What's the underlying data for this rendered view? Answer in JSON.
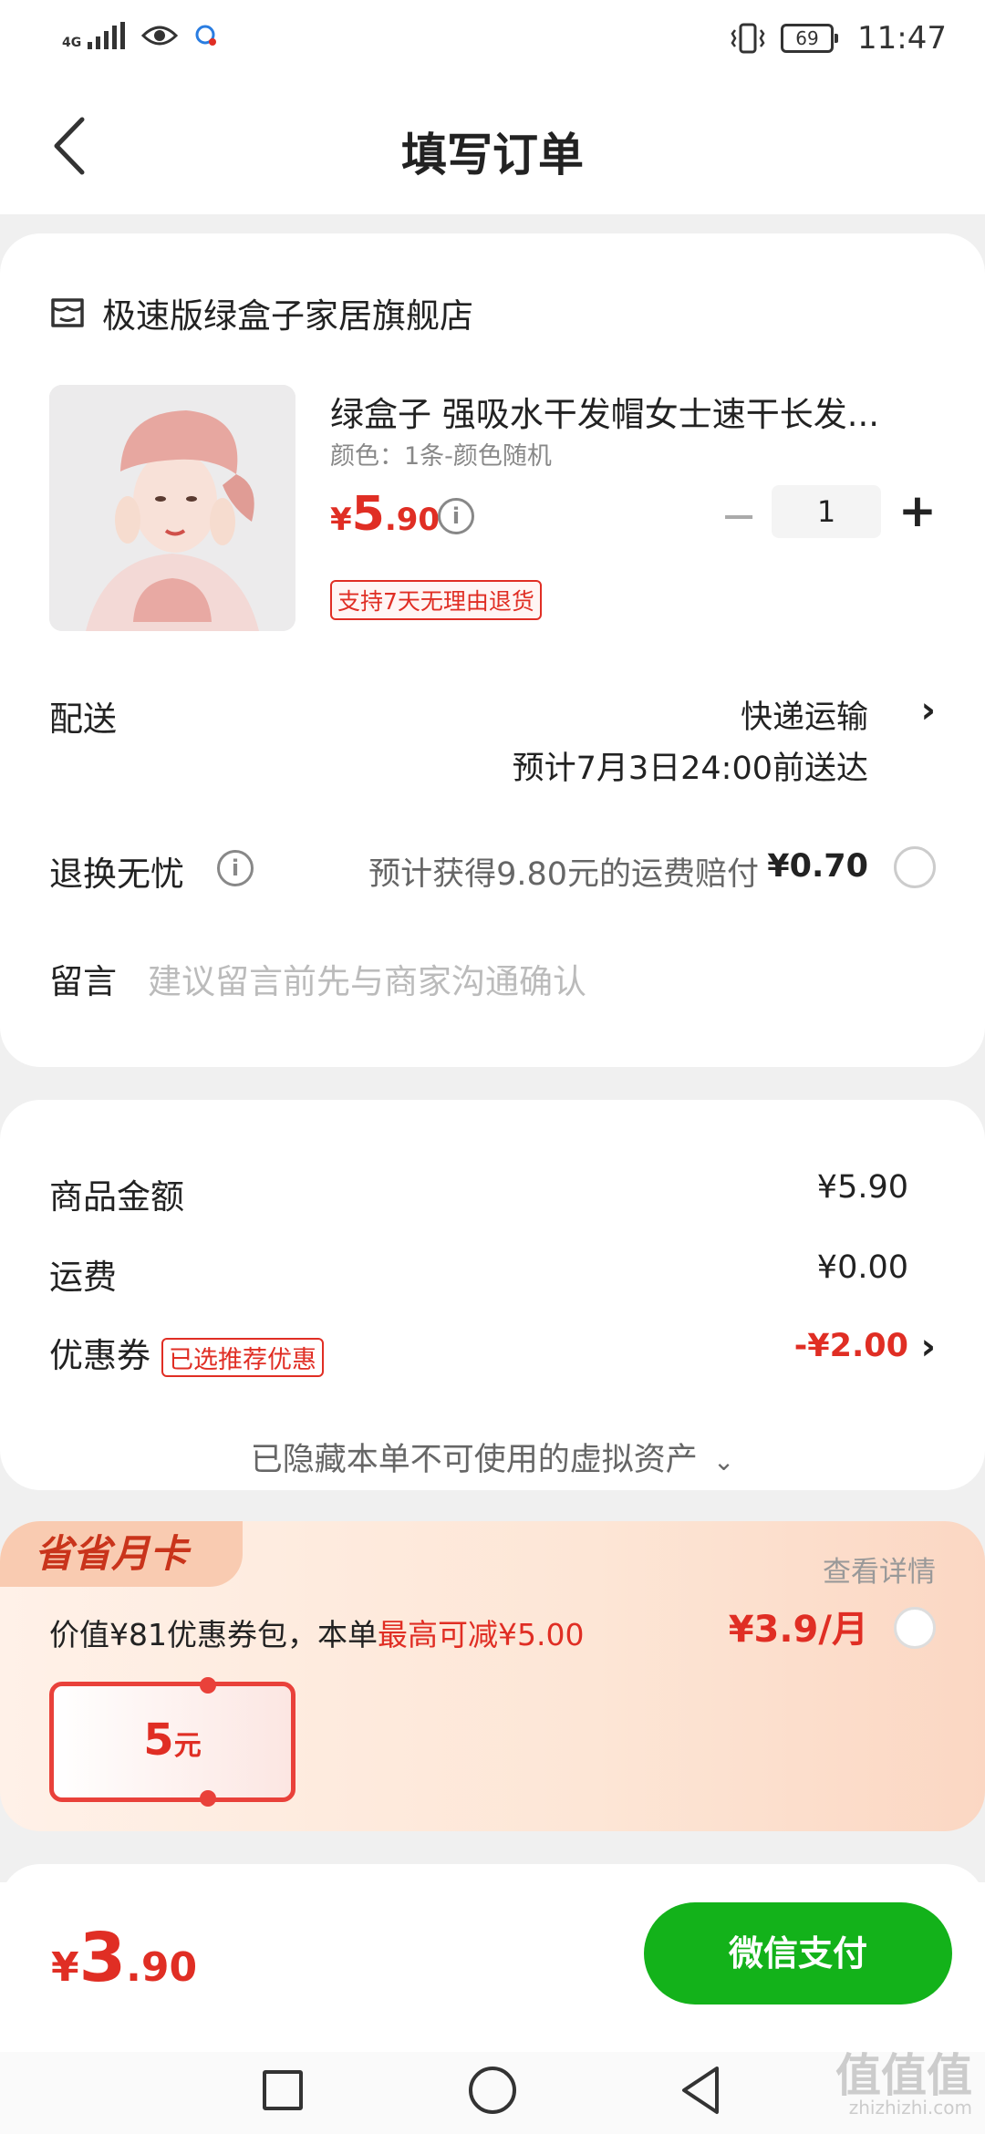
{
  "status_bar": {
    "network": "4G",
    "battery": "69",
    "time": "11:47"
  },
  "header": {
    "title": "填写订单"
  },
  "order": {
    "shop_name": "极速版绿盒子家居旗舰店",
    "product_name": "绿盒子 强吸水干发帽女士速干长发...",
    "spec": "颜色：1条-颜色随机",
    "price_symbol": "¥",
    "price_int": "5",
    "price_dec": ".90",
    "quantity": "1",
    "return_badge": "支持7天无理由退货",
    "delivery_label": "配送",
    "delivery_method": "快递运输",
    "delivery_eta": "预计7月3日24:00前送达",
    "insurance_label": "退换无忧",
    "insurance_desc": "预计获得9.80元的运费赔付",
    "insurance_price": "¥0.70",
    "message_label": "留言",
    "message_placeholder": "建议留言前先与商家沟通确认"
  },
  "summary": {
    "goods_label": "商品金额",
    "goods_value": "¥5.90",
    "shipping_label": "运费",
    "shipping_value": "¥0.00",
    "coupon_label": "优惠券",
    "coupon_badge": "已选推荐优惠",
    "coupon_value": "-¥2.00",
    "hidden_assets": "已隐藏本单不可使用的虚拟资产"
  },
  "promo": {
    "tag": "省省月卡",
    "detail_link": "查看详情",
    "desc_prefix": "价值¥81优惠券包，本单",
    "desc_highlight": "最高可减¥5.00",
    "price": "¥3.9/月",
    "ticket_value": "5",
    "ticket_unit": "元"
  },
  "bottom": {
    "total_symbol": "¥",
    "total_int": "3",
    "total_dec": ".90",
    "pay_button": "微信支付"
  },
  "watermark": {
    "main": "值值值",
    "sub": "zhizhizhi.com"
  },
  "colors": {
    "accent_red": "#e02e24",
    "pay_green": "#13b21a",
    "promo_bg": "#fde6d6"
  },
  "icons": [
    "back-arrow-icon",
    "shop-icon",
    "info-icon",
    "chevron-right-icon",
    "chevron-down-icon",
    "eye-icon",
    "vibrate-icon"
  ]
}
